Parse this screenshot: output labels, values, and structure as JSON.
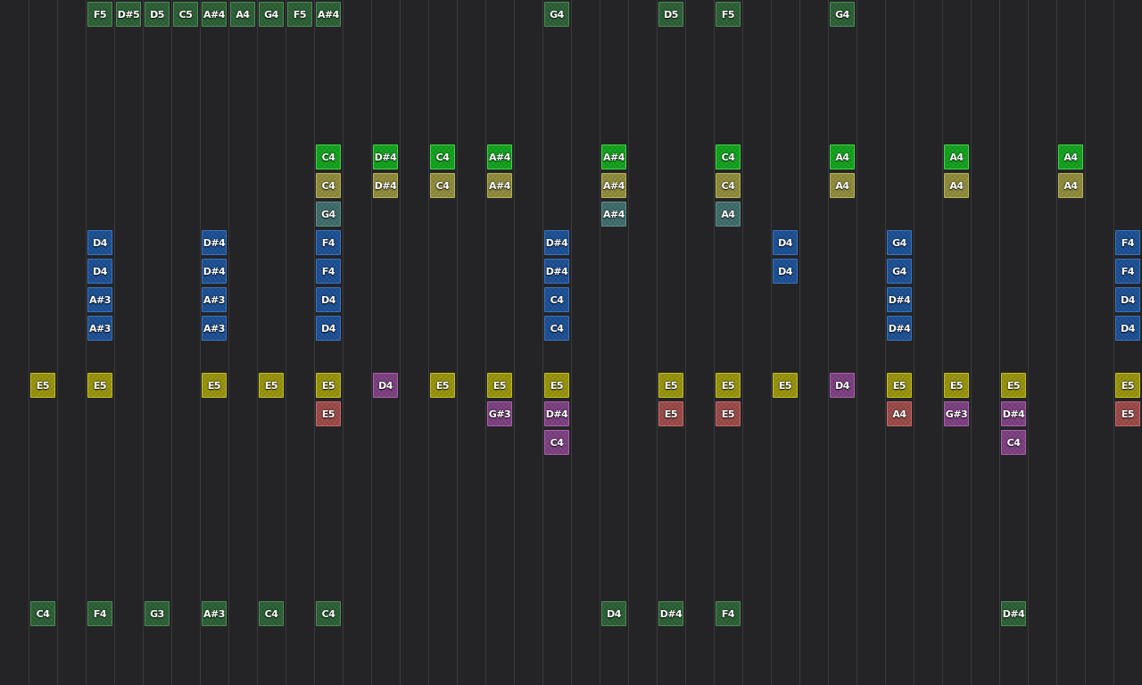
{
  "palette": {
    "dkgreen": {
      "bg": "#2b5f34",
      "border": "#4e8a57"
    },
    "green": {
      "bg": "#11a11c",
      "border": "#45d24c"
    },
    "olive": {
      "bg": "#8f8b3a",
      "border": "#b8b35a"
    },
    "teal": {
      "bg": "#3e6c6a",
      "border": "#5e8f8c"
    },
    "blue": {
      "bg": "#1b4f93",
      "border": "#3b73bd"
    },
    "yellow": {
      "bg": "#97930b",
      "border": "#c2bd24"
    },
    "purple": {
      "bg": "#7c3f80",
      "border": "#a862ab"
    },
    "red": {
      "bg": "#9a4948",
      "border": "#c26a68"
    }
  },
  "notes": [
    {
      "label": "F5",
      "col": 3,
      "row": 0,
      "color": "dkgreen"
    },
    {
      "label": "D#5",
      "col": 4,
      "row": 0,
      "color": "dkgreen"
    },
    {
      "label": "D5",
      "col": 5,
      "row": 0,
      "color": "dkgreen"
    },
    {
      "label": "C5",
      "col": 6,
      "row": 0,
      "color": "dkgreen"
    },
    {
      "label": "A#4",
      "col": 7,
      "row": 0,
      "color": "dkgreen"
    },
    {
      "label": "A4",
      "col": 8,
      "row": 0,
      "color": "dkgreen"
    },
    {
      "label": "G4",
      "col": 9,
      "row": 0,
      "color": "dkgreen"
    },
    {
      "label": "F5",
      "col": 10,
      "row": 0,
      "color": "dkgreen"
    },
    {
      "label": "A#4",
      "col": 11,
      "row": 0,
      "color": "dkgreen"
    },
    {
      "label": "G4",
      "col": 19,
      "row": 0,
      "color": "dkgreen"
    },
    {
      "label": "D5",
      "col": 23,
      "row": 0,
      "color": "dkgreen"
    },
    {
      "label": "F5",
      "col": 25,
      "row": 0,
      "color": "dkgreen"
    },
    {
      "label": "G4",
      "col": 29,
      "row": 0,
      "color": "dkgreen"
    },
    {
      "label": "C4",
      "col": 11,
      "row": 5,
      "color": "green"
    },
    {
      "label": "D#4",
      "col": 13,
      "row": 5,
      "color": "green"
    },
    {
      "label": "C4",
      "col": 15,
      "row": 5,
      "color": "green"
    },
    {
      "label": "A#4",
      "col": 17,
      "row": 5,
      "color": "green"
    },
    {
      "label": "A#4",
      "col": 21,
      "row": 5,
      "color": "green"
    },
    {
      "label": "C4",
      "col": 25,
      "row": 5,
      "color": "green"
    },
    {
      "label": "A4",
      "col": 29,
      "row": 5,
      "color": "green"
    },
    {
      "label": "A4",
      "col": 33,
      "row": 5,
      "color": "green"
    },
    {
      "label": "A4",
      "col": 37,
      "row": 5,
      "color": "green"
    },
    {
      "label": "C4",
      "col": 11,
      "row": 6,
      "color": "olive"
    },
    {
      "label": "D#4",
      "col": 13,
      "row": 6,
      "color": "olive"
    },
    {
      "label": "C4",
      "col": 15,
      "row": 6,
      "color": "olive"
    },
    {
      "label": "A#4",
      "col": 17,
      "row": 6,
      "color": "olive"
    },
    {
      "label": "A#4",
      "col": 21,
      "row": 6,
      "color": "olive"
    },
    {
      "label": "C4",
      "col": 25,
      "row": 6,
      "color": "olive"
    },
    {
      "label": "A4",
      "col": 29,
      "row": 6,
      "color": "olive"
    },
    {
      "label": "A4",
      "col": 33,
      "row": 6,
      "color": "olive"
    },
    {
      "label": "A4",
      "col": 37,
      "row": 6,
      "color": "olive"
    },
    {
      "label": "G4",
      "col": 11,
      "row": 7,
      "color": "teal"
    },
    {
      "label": "A#4",
      "col": 21,
      "row": 7,
      "color": "teal"
    },
    {
      "label": "A4",
      "col": 25,
      "row": 7,
      "color": "teal"
    },
    {
      "label": "D4",
      "col": 3,
      "row": 8,
      "color": "blue"
    },
    {
      "label": "D#4",
      "col": 7,
      "row": 8,
      "color": "blue"
    },
    {
      "label": "F4",
      "col": 11,
      "row": 8,
      "color": "blue"
    },
    {
      "label": "D#4",
      "col": 19,
      "row": 8,
      "color": "blue"
    },
    {
      "label": "D4",
      "col": 27,
      "row": 8,
      "color": "blue"
    },
    {
      "label": "G4",
      "col": 31,
      "row": 8,
      "color": "blue"
    },
    {
      "label": "F4",
      "col": 39,
      "row": 8,
      "color": "blue"
    },
    {
      "label": "D4",
      "col": 3,
      "row": 9,
      "color": "blue"
    },
    {
      "label": "D#4",
      "col": 7,
      "row": 9,
      "color": "blue"
    },
    {
      "label": "F4",
      "col": 11,
      "row": 9,
      "color": "blue"
    },
    {
      "label": "D#4",
      "col": 19,
      "row": 9,
      "color": "blue"
    },
    {
      "label": "D4",
      "col": 27,
      "row": 9,
      "color": "blue"
    },
    {
      "label": "G4",
      "col": 31,
      "row": 9,
      "color": "blue"
    },
    {
      "label": "F4",
      "col": 39,
      "row": 9,
      "color": "blue"
    },
    {
      "label": "A#3",
      "col": 3,
      "row": 10,
      "color": "blue"
    },
    {
      "label": "A#3",
      "col": 7,
      "row": 10,
      "color": "blue"
    },
    {
      "label": "D4",
      "col": 11,
      "row": 10,
      "color": "blue"
    },
    {
      "label": "C4",
      "col": 19,
      "row": 10,
      "color": "blue"
    },
    {
      "label": "D#4",
      "col": 31,
      "row": 10,
      "color": "blue"
    },
    {
      "label": "D4",
      "col": 39,
      "row": 10,
      "color": "blue"
    },
    {
      "label": "A#3",
      "col": 3,
      "row": 11,
      "color": "blue"
    },
    {
      "label": "A#3",
      "col": 7,
      "row": 11,
      "color": "blue"
    },
    {
      "label": "D4",
      "col": 11,
      "row": 11,
      "color": "blue"
    },
    {
      "label": "C4",
      "col": 19,
      "row": 11,
      "color": "blue"
    },
    {
      "label": "D#4",
      "col": 31,
      "row": 11,
      "color": "blue"
    },
    {
      "label": "D4",
      "col": 39,
      "row": 11,
      "color": "blue"
    },
    {
      "label": "E5",
      "col": 1,
      "row": 13,
      "color": "yellow"
    },
    {
      "label": "E5",
      "col": 3,
      "row": 13,
      "color": "yellow"
    },
    {
      "label": "E5",
      "col": 7,
      "row": 13,
      "color": "yellow"
    },
    {
      "label": "E5",
      "col": 9,
      "row": 13,
      "color": "yellow"
    },
    {
      "label": "E5",
      "col": 11,
      "row": 13,
      "color": "yellow"
    },
    {
      "label": "D4",
      "col": 13,
      "row": 13,
      "color": "purple"
    },
    {
      "label": "E5",
      "col": 15,
      "row": 13,
      "color": "yellow"
    },
    {
      "label": "E5",
      "col": 17,
      "row": 13,
      "color": "yellow"
    },
    {
      "label": "E5",
      "col": 19,
      "row": 13,
      "color": "yellow"
    },
    {
      "label": "E5",
      "col": 23,
      "row": 13,
      "color": "yellow"
    },
    {
      "label": "E5",
      "col": 25,
      "row": 13,
      "color": "yellow"
    },
    {
      "label": "E5",
      "col": 27,
      "row": 13,
      "color": "yellow"
    },
    {
      "label": "D4",
      "col": 29,
      "row": 13,
      "color": "purple"
    },
    {
      "label": "E5",
      "col": 31,
      "row": 13,
      "color": "yellow"
    },
    {
      "label": "E5",
      "col": 33,
      "row": 13,
      "color": "yellow"
    },
    {
      "label": "E5",
      "col": 35,
      "row": 13,
      "color": "yellow"
    },
    {
      "label": "E5",
      "col": 39,
      "row": 13,
      "color": "yellow"
    },
    {
      "label": "E5",
      "col": 11,
      "row": 14,
      "color": "red"
    },
    {
      "label": "G#3",
      "col": 17,
      "row": 14,
      "color": "purple"
    },
    {
      "label": "D#4",
      "col": 19,
      "row": 14,
      "color": "purple"
    },
    {
      "label": "E5",
      "col": 23,
      "row": 14,
      "color": "red"
    },
    {
      "label": "E5",
      "col": 25,
      "row": 14,
      "color": "red"
    },
    {
      "label": "A4",
      "col": 31,
      "row": 14,
      "color": "red"
    },
    {
      "label": "G#3",
      "col": 33,
      "row": 14,
      "color": "purple"
    },
    {
      "label": "D#4",
      "col": 35,
      "row": 14,
      "color": "purple"
    },
    {
      "label": "E5",
      "col": 39,
      "row": 14,
      "color": "red"
    },
    {
      "label": "C4",
      "col": 19,
      "row": 15,
      "color": "purple"
    },
    {
      "label": "C4",
      "col": 35,
      "row": 15,
      "color": "purple"
    },
    {
      "label": "C4",
      "col": 1,
      "row": 21,
      "color": "dkgreen"
    },
    {
      "label": "F4",
      "col": 3,
      "row": 21,
      "color": "dkgreen"
    },
    {
      "label": "G3",
      "col": 5,
      "row": 21,
      "color": "dkgreen"
    },
    {
      "label": "A#3",
      "col": 7,
      "row": 21,
      "color": "dkgreen"
    },
    {
      "label": "C4",
      "col": 9,
      "row": 21,
      "color": "dkgreen"
    },
    {
      "label": "C4",
      "col": 11,
      "row": 21,
      "color": "dkgreen"
    },
    {
      "label": "D4",
      "col": 21,
      "row": 21,
      "color": "dkgreen"
    },
    {
      "label": "D#4",
      "col": 23,
      "row": 21,
      "color": "dkgreen"
    },
    {
      "label": "F4",
      "col": 25,
      "row": 21,
      "color": "dkgreen"
    },
    {
      "label": "D#4",
      "col": 35,
      "row": 21,
      "color": "dkgreen"
    }
  ]
}
